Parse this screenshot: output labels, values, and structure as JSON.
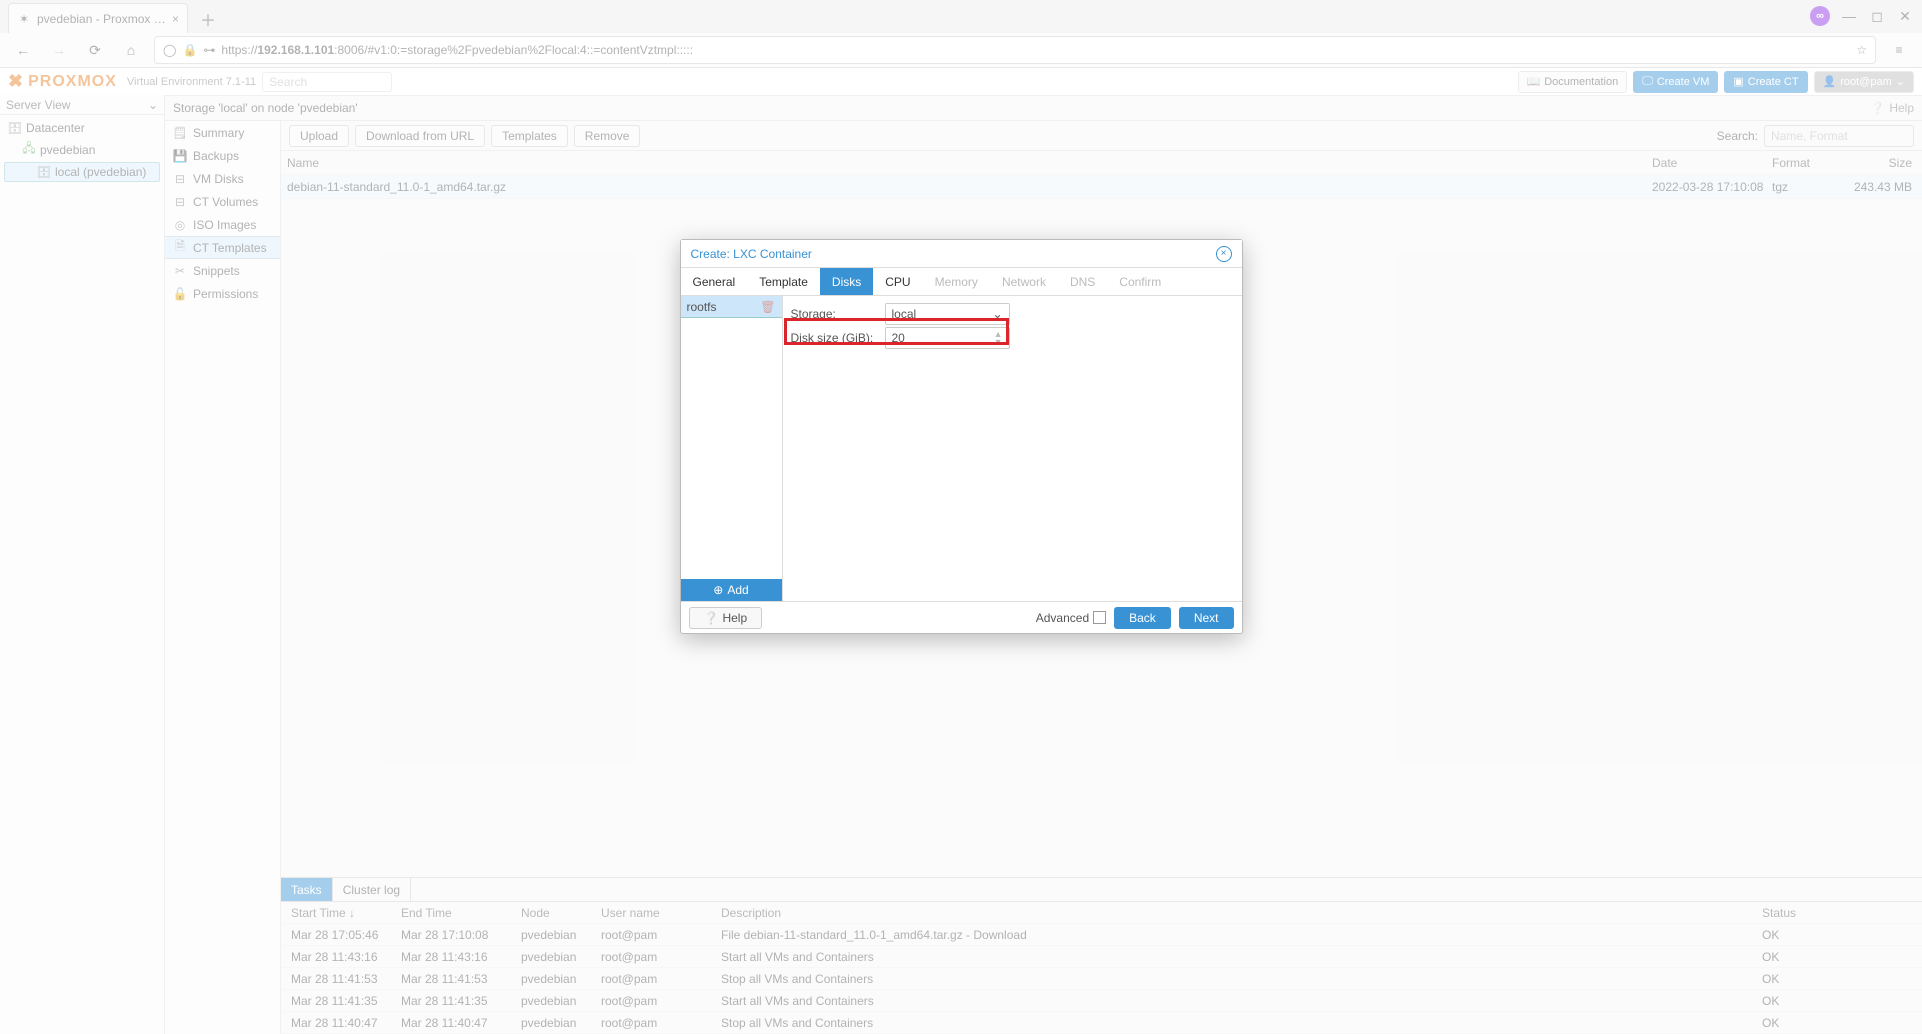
{
  "browser": {
    "tab_title": "pvedebian - Proxmox Virt",
    "url_display_prefix": "https://",
    "url_host": "192.168.1.101",
    "url_rest": ":8006/#v1:0:=storage%2Fpvedebian%2Flocal:4::=contentVztmpl:::::"
  },
  "header": {
    "brand": "PROXMOX",
    "env": "Virtual Environment 7.1-11",
    "search_placeholder": "Search",
    "doc": "Documentation",
    "create_vm": "Create VM",
    "create_ct": "Create CT",
    "user": "root@pam"
  },
  "left": {
    "title": "Server View",
    "datacenter": "Datacenter",
    "node": "pvedebian",
    "storage": "local (pvedebian)"
  },
  "crumb": "Storage 'local' on node 'pvedebian'",
  "help": "Help",
  "sidenav": [
    "Summary",
    "Backups",
    "VM Disks",
    "CT Volumes",
    "ISO Images",
    "CT Templates",
    "Snippets",
    "Permissions"
  ],
  "toolbar": {
    "upload": "Upload",
    "download": "Download from URL",
    "templates": "Templates",
    "remove": "Remove",
    "search_label": "Search:",
    "search_placeholder": "Name, Format"
  },
  "grid": {
    "headers": {
      "name": "Name",
      "date": "Date",
      "format": "Format",
      "size": "Size"
    },
    "row": {
      "name": "debian-11-standard_11.0-1_amd64.tar.gz",
      "date": "2022-03-28 17:10:08",
      "format": "tgz",
      "size": "243.43 MB"
    }
  },
  "tasks": {
    "tab_tasks": "Tasks",
    "tab_log": "Cluster log",
    "headers": {
      "start": "Start Time ↓",
      "end": "End Time",
      "node": "Node",
      "user": "User name",
      "desc": "Description",
      "status": "Status"
    },
    "rows": [
      {
        "start": "Mar 28 17:05:46",
        "end": "Mar 28 17:10:08",
        "node": "pvedebian",
        "user": "root@pam",
        "desc": "File debian-11-standard_11.0-1_amd64.tar.gz - Download",
        "status": "OK"
      },
      {
        "start": "Mar 28 11:43:16",
        "end": "Mar 28 11:43:16",
        "node": "pvedebian",
        "user": "root@pam",
        "desc": "Start all VMs and Containers",
        "status": "OK"
      },
      {
        "start": "Mar 28 11:41:53",
        "end": "Mar 28 11:41:53",
        "node": "pvedebian",
        "user": "root@pam",
        "desc": "Stop all VMs and Containers",
        "status": "OK"
      },
      {
        "start": "Mar 28 11:41:35",
        "end": "Mar 28 11:41:35",
        "node": "pvedebian",
        "user": "root@pam",
        "desc": "Start all VMs and Containers",
        "status": "OK"
      },
      {
        "start": "Mar 28 11:40:47",
        "end": "Mar 28 11:40:47",
        "node": "pvedebian",
        "user": "root@pam",
        "desc": "Stop all VMs and Containers",
        "status": "OK"
      }
    ]
  },
  "modal": {
    "title": "Create: LXC Container",
    "tabs": [
      "General",
      "Template",
      "Disks",
      "CPU",
      "Memory",
      "Network",
      "DNS",
      "Confirm"
    ],
    "active_tab": "Disks",
    "rootfs": "rootfs",
    "storage_label": "Storage:",
    "storage_value": "local",
    "disksize_label": "Disk size (GiB):",
    "disksize_value": "20",
    "add": "Add",
    "help": "Help",
    "advanced": "Advanced",
    "back": "Back",
    "next": "Next"
  }
}
